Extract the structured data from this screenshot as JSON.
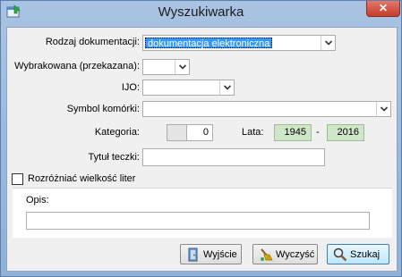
{
  "window": {
    "title": "Wyszukiwarka",
    "close_glyph": "✕"
  },
  "form": {
    "rodzaj_label": "Rodzaj dokumentacji:",
    "rodzaj_value": "dokumentacja elektroniczna",
    "wybrakowana_label": "Wybrakowana (przekazana):",
    "wybrakowana_value": "",
    "ijo_label": "IJO:",
    "ijo_value": "",
    "symbol_label": "Symbol komórki:",
    "symbol_value": "",
    "kategoria_label": "Kategoria:",
    "kategoria_value": "",
    "kategoria_number": "0",
    "lata_label": "Lata:",
    "year_from": "1945",
    "year_separator": "-",
    "year_to": "2016",
    "tytul_label": "Tytuł teczki:",
    "tytul_value": "",
    "case_label": "Rozróżniać wielkość liter",
    "case_checked": false,
    "opis_label": "Opis:",
    "opis_value": ""
  },
  "buttons": {
    "wyjscie_label": "Wyjście",
    "wyczysc_label": "Wyczyść",
    "szukaj_label": "Szukaj"
  },
  "icons": {
    "app": "app-window-icon",
    "dropdown": "chevron-down-icon",
    "exit": "exit-door-icon",
    "clear": "broom-icon",
    "search": "magnifier-icon"
  }
}
